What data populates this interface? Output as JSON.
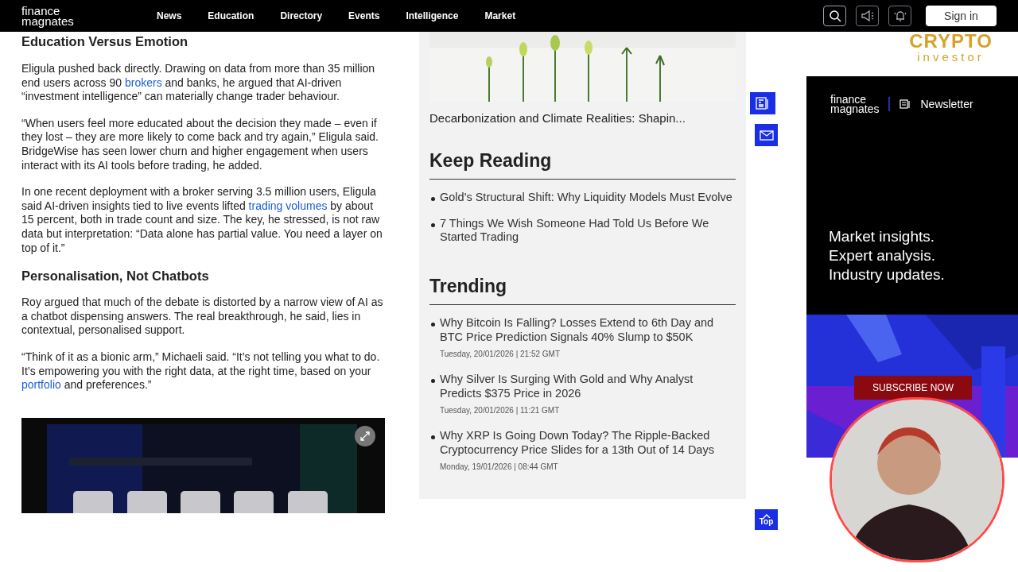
{
  "nav": {
    "logo": [
      "finance",
      "magnates"
    ],
    "links": [
      "News",
      "Education",
      "Directory",
      "Events",
      "Intelligence",
      "Market"
    ],
    "sign_in": "Sign in"
  },
  "article": [
    {
      "kind": "heading",
      "text": "Education Versus Emotion"
    },
    {
      "kind": "para",
      "parts": [
        {
          "text": "Eligula pushed back directly. Drawing on data from more than 35 million end users across 90 ",
          "kind": "text"
        },
        {
          "text": "brokers",
          "kind": "link"
        },
        {
          "text": " and banks, he argued that AI-driven “investment intelligence” can materially change trader behaviour.",
          "kind": "text"
        }
      ]
    },
    {
      "kind": "para",
      "parts": [
        {
          "text": "“When users feel more educated about the decision they made – even if they lost – they are more likely to come back and try again,” Eligula said. BridgeWise has seen lower churn and higher engagement when users interact with its AI tools before trading, he added.",
          "kind": "text"
        }
      ]
    },
    {
      "kind": "para",
      "parts": [
        {
          "text": "In one recent deployment with a broker serving 3.5 million users, Eligula said AI-driven insights tied to live events lifted ",
          "kind": "text"
        },
        {
          "text": "trading volumes",
          "kind": "link"
        },
        {
          "text": " by about 15 percent, both in trade count and size. The key, he stressed, is not raw data but interpretation: “Data alone has partial value. You need a layer on top of it.”",
          "kind": "text"
        }
      ]
    },
    {
      "kind": "heading",
      "text": "Personalisation, Not Chatbots"
    },
    {
      "kind": "para",
      "parts": [
        {
          "text": "Roy argued that much of the debate is distorted by a narrow view of AI as a chatbot dispensing answers. The real breakthrough, he said, lies in contextual, personalised support.",
          "kind": "text"
        }
      ]
    },
    {
      "kind": "para",
      "parts": [
        {
          "text": "“Think of it as a bionic arm,” Michaeli said. “It’s not telling you what to do. It’s empowering you with the right data, at the right time, based on your ",
          "kind": "text"
        },
        {
          "text": "portfolio",
          "kind": "link"
        },
        {
          "text": " and preferences.”",
          "kind": "text"
        }
      ]
    }
  ],
  "article_image": {
    "kind": "picture"
  },
  "sidebar": {
    "top_caption": "Decarbonization and Climate Realities: Shapin...",
    "keep_reading": {
      "title": "Keep Reading",
      "items": [
        "Gold's Structural Shift: Why Liquidity Models Must Evolve",
        "7 Things We Wish Someone Had Told Us Before We Started Trading"
      ]
    },
    "trending": {
      "title": "Trending",
      "items": [
        {
          "title": "Why Bitcoin Is Falling? Losses Extend to 6th Day and BTC Price Prediction Signals 40% Slump to $50K",
          "date": "Tuesday, 20/01/2026 | 21:52 GMT"
        },
        {
          "title": "Why Silver Is Surging With Gold and Why Analyst Predicts $375 Price in 2026",
          "date": "Tuesday, 20/01/2026 | 11:21 GMT"
        },
        {
          "title": "Why XRP Is Going Down Today? The Ripple-Backed Cryptocurrency Price Slides for a 13th Out of 14 Days",
          "date": "Monday, 19/01/2026 | 08:44 GMT"
        }
      ]
    }
  },
  "top_button": "Top",
  "overlay_logo": [
    "CRYPTO",
    "investor"
  ],
  "ad": {
    "logo": [
      "finance",
      "magnates"
    ],
    "newsletter": "Newsletter",
    "lines": [
      "Market insights.",
      "Expert analysis.",
      "Industry updates."
    ],
    "subscribe": "SUBSCRIBE NOW"
  }
}
